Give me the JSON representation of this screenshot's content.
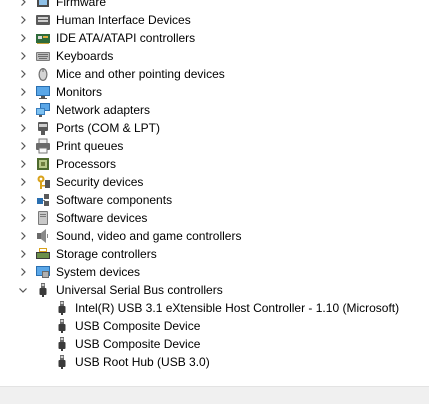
{
  "tree": {
    "categories": [
      {
        "label": "Firmware",
        "icon": "firmware-icon",
        "expanded": false
      },
      {
        "label": "Human Interface Devices",
        "icon": "hid-icon",
        "expanded": false
      },
      {
        "label": "IDE ATA/ATAPI controllers",
        "icon": "ide-controller-icon",
        "expanded": false
      },
      {
        "label": "Keyboards",
        "icon": "keyboard-icon",
        "expanded": false
      },
      {
        "label": "Mice and other pointing devices",
        "icon": "mouse-icon",
        "expanded": false
      },
      {
        "label": "Monitors",
        "icon": "monitor-icon",
        "expanded": false
      },
      {
        "label": "Network adapters",
        "icon": "network-adapter-icon",
        "expanded": false
      },
      {
        "label": "Ports (COM & LPT)",
        "icon": "port-icon",
        "expanded": false
      },
      {
        "label": "Print queues",
        "icon": "printer-icon",
        "expanded": false
      },
      {
        "label": "Processors",
        "icon": "processor-icon",
        "expanded": false
      },
      {
        "label": "Security devices",
        "icon": "security-key-icon",
        "expanded": false
      },
      {
        "label": "Software components",
        "icon": "software-component-icon",
        "expanded": false
      },
      {
        "label": "Software devices",
        "icon": "software-device-icon",
        "expanded": false
      },
      {
        "label": "Sound, video and game controllers",
        "icon": "speaker-icon",
        "expanded": false
      },
      {
        "label": "Storage controllers",
        "icon": "storage-controller-icon",
        "expanded": false
      },
      {
        "label": "System devices",
        "icon": "system-device-icon",
        "expanded": false
      },
      {
        "label": "Universal Serial Bus controllers",
        "icon": "usb-icon",
        "expanded": true
      }
    ],
    "usb_children": [
      {
        "label": "Intel(R) USB 3.1 eXtensible Host Controller - 1.10 (Microsoft)",
        "icon": "usb-icon"
      },
      {
        "label": "USB Composite Device",
        "icon": "usb-icon"
      },
      {
        "label": "USB Composite Device",
        "icon": "usb-icon"
      },
      {
        "label": "USB Root Hub (USB 3.0)",
        "icon": "usb-icon"
      }
    ]
  }
}
